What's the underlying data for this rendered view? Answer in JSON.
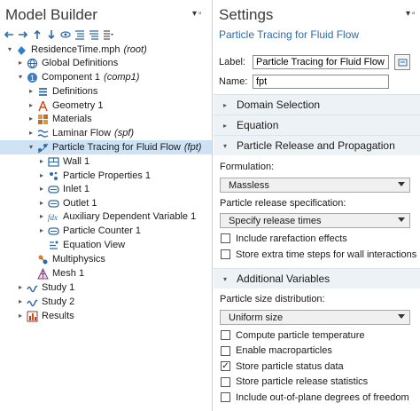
{
  "model_builder": {
    "title": "Model Builder",
    "tree": [
      {
        "label": "ResidenceTime.mph",
        "tag": "(root)",
        "icon": "root-file-icon",
        "toggle": "▾"
      },
      {
        "label": "Global Definitions",
        "tag": "",
        "icon": "globe-icon",
        "toggle": "▸"
      },
      {
        "label": "Component 1",
        "tag": "(comp1)",
        "icon": "component-icon",
        "toggle": "▾"
      },
      {
        "label": "Definitions",
        "tag": "",
        "icon": "definitions-icon",
        "toggle": "▸"
      },
      {
        "label": "Geometry 1",
        "tag": "",
        "icon": "geometry-icon",
        "toggle": "▸"
      },
      {
        "label": "Materials",
        "tag": "",
        "icon": "materials-icon",
        "toggle": "▸"
      },
      {
        "label": "Laminar Flow",
        "tag": "(spf)",
        "icon": "laminar-flow-icon",
        "toggle": "▸"
      },
      {
        "label": "Particle Tracing for Fluid Flow",
        "tag": "(fpt)",
        "icon": "particle-tracing-icon",
        "toggle": "▾"
      },
      {
        "label": "Wall 1",
        "tag": "",
        "icon": "wall-icon",
        "toggle": "▸"
      },
      {
        "label": "Particle Properties 1",
        "tag": "",
        "icon": "particle-properties-icon",
        "toggle": "▸"
      },
      {
        "label": "Inlet 1",
        "tag": "",
        "icon": "inlet-icon",
        "toggle": "▸"
      },
      {
        "label": "Outlet 1",
        "tag": "",
        "icon": "outlet-icon",
        "toggle": "▸"
      },
      {
        "label": "Auxiliary Dependent Variable 1",
        "tag": "",
        "icon": "auxiliary-variable-icon",
        "toggle": "▸"
      },
      {
        "label": "Particle Counter 1",
        "tag": "",
        "icon": "particle-counter-icon",
        "toggle": "▸"
      },
      {
        "label": "Equation View",
        "tag": "",
        "icon": "equation-view-icon",
        "toggle": ""
      },
      {
        "label": "Multiphysics",
        "tag": "",
        "icon": "multiphysics-icon",
        "toggle": ""
      },
      {
        "label": "Mesh 1",
        "tag": "",
        "icon": "mesh-icon",
        "toggle": ""
      },
      {
        "label": "Study 1",
        "tag": "",
        "icon": "study-icon",
        "toggle": "▸"
      },
      {
        "label": "Study 2",
        "tag": "",
        "icon": "study-icon",
        "toggle": "▸"
      },
      {
        "label": "Results",
        "tag": "",
        "icon": "results-icon",
        "toggle": "▸"
      }
    ]
  },
  "settings": {
    "title": "Settings",
    "subtitle": "Particle Tracing for Fluid Flow",
    "label_caption": "Label:",
    "label_value": "Particle Tracing for Fluid Flow",
    "name_caption": "Name:",
    "name_value": "fpt",
    "sections": {
      "domain_selection": "Domain Selection",
      "equation": "Equation",
      "release": "Particle Release and Propagation",
      "additional": "Additional Variables"
    },
    "formulation_label": "Formulation:",
    "formulation_value": "Massless",
    "release_spec_label": "Particle release specification:",
    "release_spec_value": "Specify release times",
    "release_checks": [
      {
        "label": "Include rarefaction effects",
        "checked": false
      },
      {
        "label": "Store extra time steps for wall interactions",
        "checked": false
      }
    ],
    "size_dist_label": "Particle size distribution:",
    "size_dist_value": "Uniform size",
    "additional_checks": [
      {
        "label": "Compute particle temperature",
        "checked": false
      },
      {
        "label": "Enable macroparticles",
        "checked": false
      },
      {
        "label": "Store particle status data",
        "checked": true
      },
      {
        "label": "Store particle release statistics",
        "checked": false
      },
      {
        "label": "Include out-of-plane degrees of freedom",
        "checked": false
      }
    ]
  },
  "colors": {
    "accent_blue": "#2f6aa6",
    "selection": "#cde3f5",
    "section_bg": "#edf2f7"
  }
}
